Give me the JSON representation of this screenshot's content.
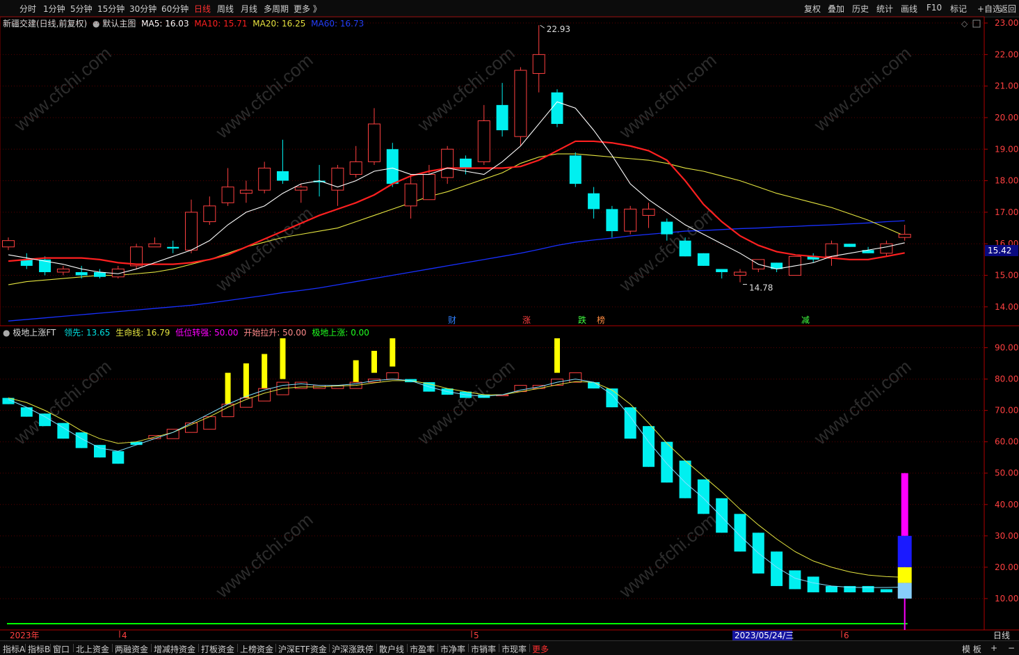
{
  "toolbar": {
    "periods": [
      "分时",
      "1分钟",
      "5分钟",
      "15分钟",
      "30分钟",
      "60分钟",
      "日线",
      "周线",
      "月线",
      "多周期",
      "更多 》"
    ],
    "active_period": "日线",
    "right_buttons": [
      "复权",
      "叠加",
      "历史",
      "统计",
      "画线",
      "F10",
      "标记",
      "+自选",
      "返回"
    ]
  },
  "main_legend": {
    "stock": "新疆交建(日线,前复权)",
    "template": "默认主图",
    "ma5": "MA5: 16.03",
    "ma10": "MA10: 15.71",
    "ma20": "MA20: 16.25",
    "ma60": "MA60: 16.73"
  },
  "sub_legend": {
    "name": "极地上涨FT",
    "lead": "领先: 13.65",
    "life": "生命线: 16.79",
    "low_turn": "低位转强: 50.00",
    "start_lift": "开始拉升: 50.00",
    "polar_rise": "极地上涨: 0.00"
  },
  "price_axis": [
    "23.00",
    "22.00",
    "21.00",
    "20.00",
    "19.00",
    "18.00",
    "17.00",
    "16.00",
    "15.00",
    "14.00"
  ],
  "price_tag": "15.42",
  "sub_axis": [
    "90.00",
    "80.00",
    "70.00",
    "60.00",
    "50.00",
    "40.00",
    "30.00",
    "20.00",
    "10.00"
  ],
  "annotations": {
    "high": "22.93",
    "low": "14.78"
  },
  "event_marks": [
    "财",
    "涨",
    "跌",
    "榜",
    "减"
  ],
  "x_labels": {
    "year": "2023年",
    "apr": "4",
    "may": "5",
    "jun": "6",
    "cursor": "2023/05/24/三",
    "period": "日线"
  },
  "bottom_tabs": [
    "指标A",
    "指标B",
    "窗口",
    "北上资金",
    "两融资金",
    "增减持资金",
    "打板资金",
    "上榜资金",
    "沪深ETF资金",
    "沪深涨跌停",
    "散户线",
    "市盈率",
    "市净率",
    "市销率",
    "市现率",
    "更多"
  ],
  "bottom_right": [
    "模 板",
    "+",
    "−"
  ],
  "watermark": "www.cfchi.com",
  "colors": {
    "up": "#ff4040",
    "down": "#00f0f0",
    "ma5": "#ffffff",
    "ma10": "#ff2020",
    "ma20": "#e6e640",
    "ma60": "#1830ff",
    "signal": "#ffff00",
    "magenta": "#ff00ff",
    "green": "#00ff00"
  },
  "chart_data": [
    {
      "type": "candlestick",
      "title": "新疆交建(日线,前复权)",
      "ylim": [
        13.4,
        23.2
      ],
      "candles": [
        [
          15.9,
          16.1,
          16.2,
          15.8
        ],
        [
          15.5,
          15.3,
          15.7,
          15.2
        ],
        [
          15.5,
          15.1,
          15.6,
          15.0
        ],
        [
          15.1,
          15.2,
          15.3,
          15.0
        ],
        [
          15.1,
          15.0,
          15.3,
          14.9
        ],
        [
          15.1,
          14.95,
          15.2,
          14.9
        ],
        [
          14.95,
          15.2,
          15.3,
          14.9
        ],
        [
          15.3,
          15.9,
          16.0,
          15.2
        ],
        [
          15.9,
          16.0,
          16.2,
          15.9
        ],
        [
          15.9,
          15.85,
          16.1,
          15.7
        ],
        [
          15.8,
          17.0,
          17.4,
          15.7
        ],
        [
          16.7,
          17.2,
          17.5,
          16.6
        ],
        [
          17.3,
          17.8,
          18.4,
          17.2
        ],
        [
          17.6,
          17.7,
          18.0,
          17.3
        ],
        [
          17.7,
          18.4,
          18.6,
          17.6
        ],
        [
          18.3,
          18.0,
          19.3,
          17.9
        ],
        [
          17.7,
          17.8,
          17.9,
          17.3
        ],
        [
          18.0,
          17.95,
          18.5,
          17.5
        ],
        [
          17.7,
          18.4,
          18.5,
          17.2
        ],
        [
          18.2,
          18.6,
          19.1,
          18.1
        ],
        [
          18.6,
          19.8,
          20.3,
          18.5
        ],
        [
          19.0,
          17.9,
          19.2,
          17.8
        ],
        [
          17.2,
          17.9,
          18.2,
          16.8
        ],
        [
          17.4,
          18.2,
          18.5,
          17.4
        ],
        [
          18.1,
          19.0,
          19.1,
          17.9
        ],
        [
          18.7,
          18.4,
          18.8,
          18.2
        ],
        [
          18.6,
          19.9,
          20.4,
          18.5
        ],
        [
          20.4,
          19.6,
          21.1,
          19.4
        ],
        [
          19.4,
          21.5,
          21.6,
          19.1
        ],
        [
          21.4,
          22.0,
          22.93,
          20.8
        ],
        [
          20.8,
          19.8,
          20.9,
          19.7
        ],
        [
          18.8,
          17.9,
          18.9,
          17.8
        ],
        [
          17.6,
          17.1,
          17.8,
          16.8
        ],
        [
          17.1,
          16.4,
          17.2,
          16.2
        ],
        [
          16.4,
          17.1,
          17.2,
          16.3
        ],
        [
          16.9,
          17.1,
          17.3,
          16.5
        ],
        [
          16.7,
          16.3,
          16.8,
          16.1
        ],
        [
          16.1,
          15.6,
          16.2,
          15.6
        ],
        [
          15.7,
          15.3,
          15.7,
          15.3
        ],
        [
          15.2,
          15.1,
          15.2,
          14.9
        ],
        [
          15.0,
          15.1,
          15.2,
          14.78
        ],
        [
          15.2,
          15.5,
          15.5,
          15.1
        ],
        [
          15.4,
          15.2,
          15.4,
          15.1
        ],
        [
          15.0,
          15.6,
          15.6,
          15.0
        ],
        [
          15.6,
          15.5,
          15.7,
          15.4
        ],
        [
          15.6,
          16.0,
          16.1,
          15.3
        ],
        [
          16.0,
          15.9,
          16.0,
          15.9
        ],
        [
          15.8,
          15.7,
          15.9,
          15.7
        ],
        [
          15.7,
          16.0,
          16.1,
          15.6
        ],
        [
          16.2,
          16.3,
          16.6,
          16.1
        ]
      ],
      "ma5": [
        15.65,
        15.55,
        15.45,
        15.35,
        15.2,
        15.1,
        15.05,
        15.2,
        15.4,
        15.6,
        15.8,
        16.1,
        16.6,
        17.0,
        17.2,
        17.6,
        17.9,
        18.0,
        17.8,
        18.0,
        18.3,
        18.4,
        18.2,
        18.2,
        18.4,
        18.3,
        18.2,
        18.6,
        19.1,
        19.8,
        20.5,
        20.3,
        19.6,
        18.8,
        17.9,
        17.4,
        17.0,
        16.6,
        16.3,
        16.0,
        15.7,
        15.35,
        15.2,
        15.3,
        15.4,
        15.6,
        15.7,
        15.8,
        15.9,
        16.03
      ],
      "ma10": [
        15.45,
        15.5,
        15.55,
        15.55,
        15.55,
        15.5,
        15.4,
        15.35,
        15.35,
        15.35,
        15.4,
        15.5,
        15.65,
        15.9,
        16.15,
        16.4,
        16.65,
        16.9,
        17.1,
        17.3,
        17.55,
        17.9,
        18.15,
        18.3,
        18.4,
        18.4,
        18.4,
        18.4,
        18.45,
        18.65,
        18.95,
        19.25,
        19.25,
        19.2,
        19.1,
        18.95,
        18.65,
        18.0,
        17.25,
        16.7,
        16.25,
        15.95,
        15.75,
        15.65,
        15.6,
        15.55,
        15.5,
        15.5,
        15.6,
        15.71
      ],
      "ma20": [
        14.7,
        14.8,
        14.85,
        14.9,
        14.95,
        15.0,
        15.0,
        15.05,
        15.1,
        15.2,
        15.35,
        15.5,
        15.7,
        15.9,
        16.05,
        16.2,
        16.3,
        16.4,
        16.5,
        16.7,
        16.9,
        17.1,
        17.3,
        17.5,
        17.65,
        17.85,
        18.05,
        18.25,
        18.55,
        18.75,
        18.85,
        18.85,
        18.8,
        18.75,
        18.7,
        18.65,
        18.55,
        18.4,
        18.3,
        18.15,
        18.0,
        17.8,
        17.6,
        17.45,
        17.3,
        17.15,
        16.95,
        16.75,
        16.5,
        16.25
      ],
      "ma60": [
        13.55,
        13.6,
        13.65,
        13.7,
        13.75,
        13.8,
        13.85,
        13.9,
        13.95,
        14.0,
        14.05,
        14.12,
        14.2,
        14.28,
        14.36,
        14.45,
        14.52,
        14.6,
        14.7,
        14.8,
        14.9,
        15.0,
        15.1,
        15.2,
        15.3,
        15.4,
        15.5,
        15.6,
        15.7,
        15.82,
        15.95,
        16.05,
        16.12,
        16.18,
        16.25,
        16.3,
        16.35,
        16.4,
        16.42,
        16.45,
        16.48,
        16.5,
        16.53,
        16.55,
        16.58,
        16.6,
        16.63,
        16.66,
        16.7,
        16.73
      ]
    },
    {
      "type": "candlestick",
      "title": "极地上涨FT",
      "ylim": [
        0,
        97
      ],
      "candles": [
        [
          74,
          72,
          74,
          72
        ],
        [
          71,
          68,
          71,
          68
        ],
        [
          69,
          65,
          69,
          65
        ],
        [
          66,
          61,
          66,
          61
        ],
        [
          63,
          58,
          63,
          58
        ],
        [
          59,
          55,
          59,
          55
        ],
        [
          57,
          53,
          57,
          53
        ],
        [
          60,
          59,
          60,
          59
        ],
        [
          61,
          62,
          62,
          61
        ],
        [
          61,
          64,
          64,
          61
        ],
        [
          63,
          66,
          66,
          63
        ],
        [
          64,
          68,
          68,
          64
        ],
        [
          68,
          72,
          72,
          68
        ],
        [
          71,
          74,
          74,
          71
        ],
        [
          73,
          77,
          77,
          73
        ],
        [
          75,
          79,
          79,
          75
        ],
        [
          77,
          79,
          79,
          77
        ],
        [
          77,
          78,
          78,
          77
        ],
        [
          77,
          78,
          78,
          77
        ],
        [
          77,
          79,
          79,
          77
        ],
        [
          79,
          80,
          80,
          79
        ],
        [
          80,
          82,
          82,
          80
        ],
        [
          80,
          79,
          80,
          79
        ],
        [
          79,
          76,
          79,
          76
        ],
        [
          77,
          75,
          77,
          75
        ],
        [
          76,
          74,
          76,
          74
        ],
        [
          75,
          74,
          75,
          74
        ],
        [
          75,
          75,
          75,
          75
        ],
        [
          76,
          78,
          78,
          76
        ],
        [
          77,
          78,
          78,
          77
        ],
        [
          78,
          80,
          80,
          78
        ],
        [
          79,
          82,
          82,
          79
        ],
        [
          79,
          77,
          79,
          77
        ],
        [
          77,
          71,
          77,
          71
        ],
        [
          71,
          61,
          71,
          61
        ],
        [
          65,
          52,
          65,
          52
        ],
        [
          60,
          47,
          60,
          47
        ],
        [
          54,
          42,
          54,
          42
        ],
        [
          48,
          37,
          48,
          37
        ],
        [
          42,
          31,
          42,
          31
        ],
        [
          37,
          25,
          37,
          25
        ],
        [
          31,
          18,
          31,
          18
        ],
        [
          25,
          14,
          25,
          14
        ],
        [
          19,
          13,
          19,
          13
        ],
        [
          17,
          12,
          17,
          12
        ],
        [
          14,
          12,
          14,
          12
        ],
        [
          14,
          12,
          14,
          12
        ],
        [
          14,
          12,
          14,
          12
        ],
        [
          13,
          12,
          13,
          12
        ],
        [
          13,
          12,
          13,
          12
        ]
      ],
      "lead": [
        73.5,
        71,
        68,
        64.5,
        61,
        58,
        57,
        59,
        61,
        63,
        66,
        69,
        72,
        74.5,
        76.5,
        78,
        78.5,
        78,
        78,
        78.5,
        79.5,
        80,
        79.5,
        77.5,
        76,
        75,
        74.5,
        75,
        76.5,
        77.5,
        79,
        80,
        79,
        75,
        68,
        60,
        53,
        47,
        42,
        36,
        30,
        24.5,
        20,
        16.5,
        15,
        14,
        13.6,
        13.5,
        13.55,
        13.65
      ],
      "life": [
        74,
        72.5,
        70,
        67,
        63.5,
        61,
        59.5,
        60,
        61.5,
        63,
        65.5,
        68,
        71,
        73.5,
        75.5,
        77,
        77.5,
        77.5,
        77.8,
        78,
        78.8,
        79.5,
        79.5,
        78.5,
        77,
        76,
        75,
        75,
        76,
        77,
        78.2,
        79.2,
        79,
        76.5,
        72,
        66,
        59.5,
        54,
        49,
        44,
        38.5,
        33.5,
        29,
        25,
        22,
        20,
        18.5,
        17.5,
        17,
        16.79
      ],
      "signals": [
        null,
        null,
        null,
        null,
        null,
        null,
        null,
        null,
        null,
        null,
        null,
        null,
        [
          72,
          82
        ],
        [
          74,
          85
        ],
        [
          75,
          88
        ],
        [
          80,
          93
        ],
        null,
        null,
        null,
        [
          78,
          86
        ],
        [
          82,
          89
        ],
        [
          84,
          93
        ],
        null,
        null,
        null,
        null,
        null,
        null,
        null,
        null,
        [
          82,
          93
        ],
        null,
        null,
        null,
        null,
        null,
        null,
        null,
        null,
        null,
        null,
        null,
        null,
        null,
        null,
        null,
        null,
        null,
        null,
        null
      ],
      "low_turn": 50.0,
      "start_lift": 50.0,
      "polar_rise": 0.0
    }
  ]
}
